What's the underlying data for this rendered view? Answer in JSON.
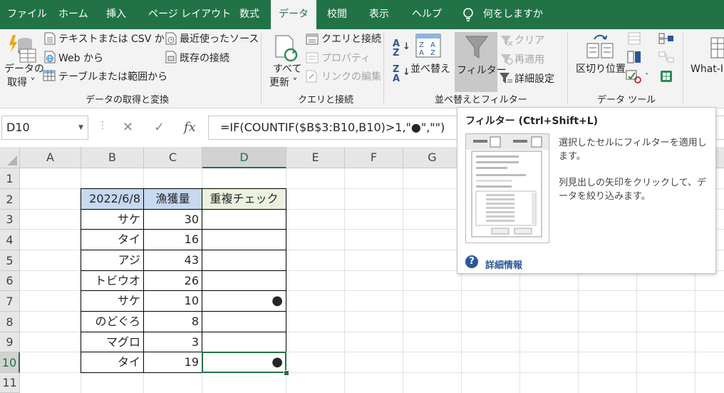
{
  "tabs": [
    {
      "label": "ファイル"
    },
    {
      "label": "ホーム"
    },
    {
      "label": "挿入"
    },
    {
      "label": "ページ レイアウト"
    },
    {
      "label": "数式"
    },
    {
      "label": "データ",
      "active": true
    },
    {
      "label": "校閲"
    },
    {
      "label": "表示"
    },
    {
      "label": "ヘルプ"
    }
  ],
  "tell_me": "何をしますか",
  "ribbon": {
    "get_data": {
      "line1": "データの",
      "line2": "取得 ˅"
    },
    "text_csv": "テキストまたは CSV から",
    "web": "Web から",
    "table_range": "テーブルまたは範囲から",
    "recent_sources": "最近使ったソース",
    "existing_connections": "既存の接続",
    "group_get": "データの取得と変換",
    "refresh_all": {
      "line1": "すべて",
      "line2": "更新 ˅"
    },
    "queries_connections": "クエリと接続",
    "properties": "プロパティ",
    "edit_links": "リンクの編集",
    "group_queries": "クエリと接続",
    "sort": "並べ替え",
    "filter": "フィルター",
    "clear": "クリア",
    "reapply": "再適用",
    "advanced": "詳細設定",
    "group_sort": "並べ替えとフィルター",
    "text_to_columns": "区切り位置",
    "group_tools": "データ ツール",
    "what_if": "What-I"
  },
  "formula_bar": {
    "name_box": "D10",
    "cancel": "✕",
    "enter": "✓",
    "fx": "fx",
    "formula": "=IF(COUNTIF($B$3:B10,B10)>1,\"●\",\"\")"
  },
  "columns": [
    "A",
    "B",
    "C",
    "D",
    "E",
    "F",
    "G"
  ],
  "rows": [
    "1",
    "2",
    "3",
    "4",
    "5",
    "6",
    "7",
    "8",
    "9",
    "10",
    "11"
  ],
  "selected_cell": "D10",
  "table": {
    "header": {
      "b": "2022/6/8",
      "c": "漁獲量",
      "d": "重複チェック"
    },
    "rows": [
      {
        "fish": "サケ",
        "amount": "30",
        "check": ""
      },
      {
        "fish": "タイ",
        "amount": "16",
        "check": ""
      },
      {
        "fish": "アジ",
        "amount": "43",
        "check": ""
      },
      {
        "fish": "トビウオ",
        "amount": "26",
        "check": ""
      },
      {
        "fish": "サケ",
        "amount": "10",
        "check": "●"
      },
      {
        "fish": "のどぐろ",
        "amount": "8",
        "check": ""
      },
      {
        "fish": "マグロ",
        "amount": "3",
        "check": ""
      },
      {
        "fish": "タイ",
        "amount": "19",
        "check": "●"
      }
    ]
  },
  "colors": {
    "ribbon_green": "#217346",
    "header_blue": "#c5d9f1",
    "header_green": "#ebf1de",
    "link_blue": "#2b579a"
  },
  "tooltip": {
    "title": "フィルター (Ctrl+Shift+L)",
    "desc1": "選択したセルにフィルターを適用します。",
    "desc2": "列見出しの矢印をクリックして、データを絞り込みます。",
    "more": "詳細情報"
  }
}
